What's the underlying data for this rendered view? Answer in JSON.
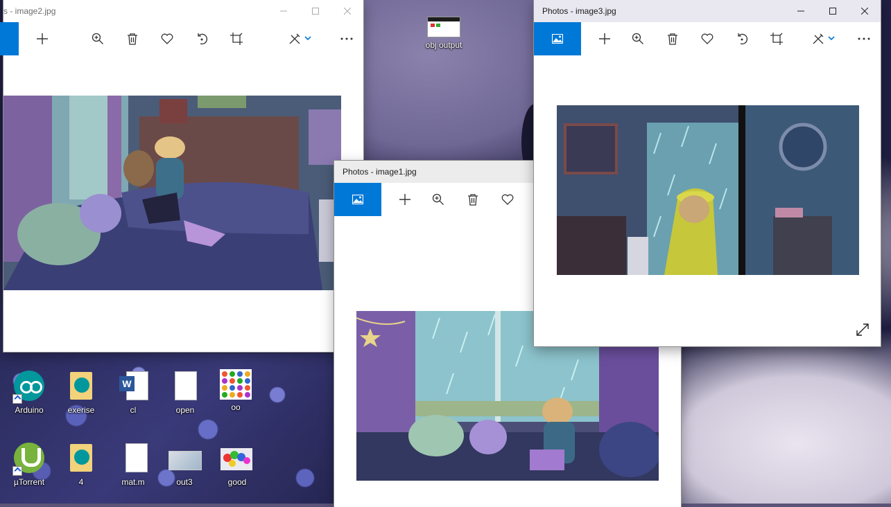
{
  "desktop": {
    "icons": [
      {
        "label": "Arduino"
      },
      {
        "label": "exerise"
      },
      {
        "label": "cl"
      },
      {
        "label": "open"
      },
      {
        "label": "oo"
      },
      {
        "label": "µTorrent"
      },
      {
        "label": "4"
      },
      {
        "label": "mat.m"
      },
      {
        "label": "out3"
      },
      {
        "label": "good"
      },
      {
        "label": "obj output"
      }
    ]
  },
  "windows": {
    "image2": {
      "title": "s - image2.jpg"
    },
    "image1": {
      "title": "Photos - image1.jpg"
    },
    "image3": {
      "title": "Photos - image3.jpg"
    }
  },
  "toolbar_icons": [
    "photos-home-icon",
    "add-icon",
    "zoom-icon",
    "delete-icon",
    "heart-icon",
    "rotate-icon",
    "crop-icon",
    "edit-create-icon",
    "more-icon"
  ],
  "colors": {
    "accent": "#0078d7"
  }
}
